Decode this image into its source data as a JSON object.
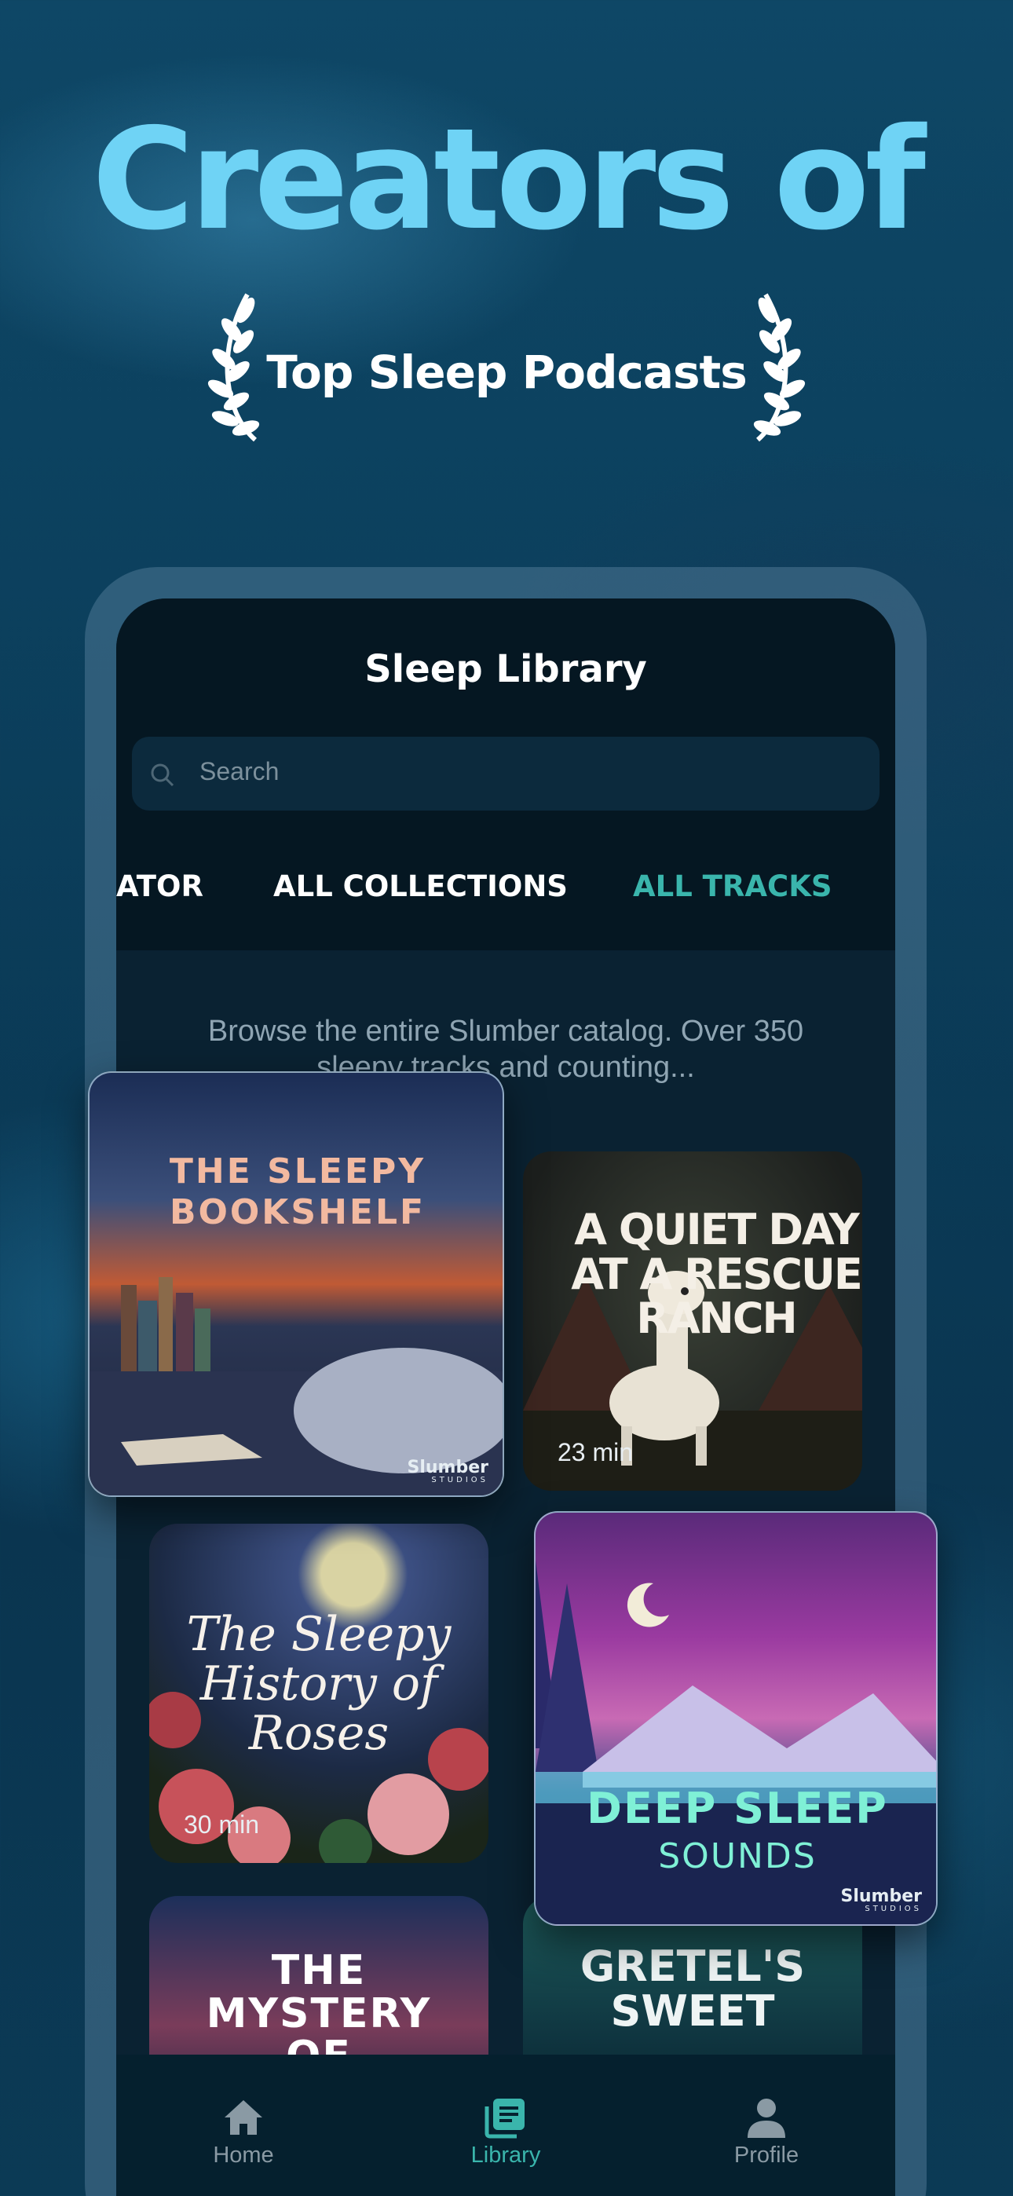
{
  "hero": {
    "headline": "Creators of",
    "award_text": "Top Sleep Podcasts"
  },
  "app": {
    "title": "Sleep Library",
    "search_placeholder": "Search",
    "tabs": [
      {
        "label": "ATOR",
        "active": false
      },
      {
        "label": "ALL COLLECTIONS",
        "active": false
      },
      {
        "label": "ALL TRACKS",
        "active": true
      }
    ],
    "intro": "Browse the entire Slumber catalog. Over 350 sleepy tracks and counting...",
    "tracks": [
      {
        "title": "A QUIET DAY AT A RESCUE RANCH",
        "duration": "23 min"
      },
      {
        "title": "The Sleepy History of Roses",
        "duration": "30 min"
      },
      {
        "title": "THE MYSTERY OF",
        "duration": ""
      },
      {
        "title": "GRETEL'S SWEET",
        "duration": ""
      }
    ],
    "bottom_nav": [
      {
        "label": "Home",
        "icon": "home-icon",
        "active": false
      },
      {
        "label": "Library",
        "icon": "library-icon",
        "active": true
      },
      {
        "label": "Profile",
        "icon": "profile-icon",
        "active": false
      }
    ]
  },
  "featured": [
    {
      "title": "THE SLEEPY BOOKSHELF",
      "brand": "Slumber",
      "brand_sub": "STUDIOS"
    },
    {
      "title": "DEEP SLEEP",
      "subtitle": "SOUNDS",
      "brand": "Slumber",
      "brand_sub": "STUDIOS"
    }
  ],
  "colors": {
    "accent": "#3ab5ac",
    "headline": "#6fd3f5",
    "background": "#0b3e5b"
  }
}
